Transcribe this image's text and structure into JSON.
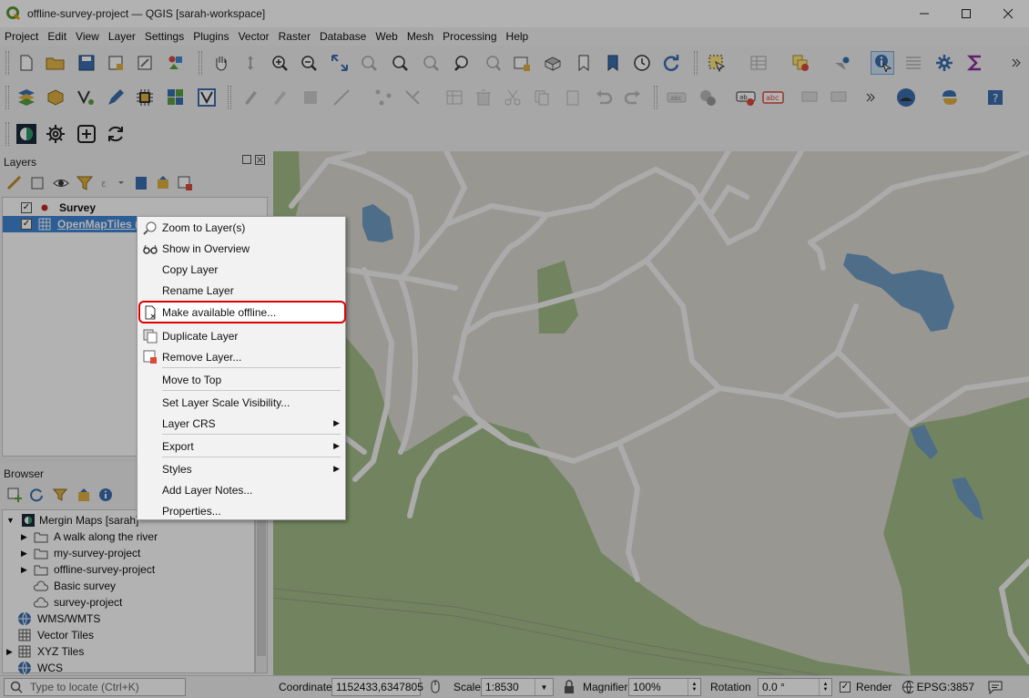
{
  "window": {
    "title": "offline-survey-project — QGIS [sarah-workspace]"
  },
  "menubar": [
    "Project",
    "Edit",
    "View",
    "Layer",
    "Settings",
    "Plugins",
    "Vector",
    "Raster",
    "Database",
    "Web",
    "Mesh",
    "Processing",
    "Help"
  ],
  "layers_panel": {
    "title": "Layers",
    "layers": [
      {
        "name": "Survey",
        "checked": true,
        "icon": "point-layer-icon"
      },
      {
        "name": "OpenMapTiles (",
        "checked": true,
        "icon": "vector-tile-layer-icon",
        "selected": true
      }
    ]
  },
  "context_menu": {
    "items": [
      {
        "label": "Zoom to Layer(s)",
        "icon": "zoom-to-layer-icon"
      },
      {
        "label": "Show in Overview",
        "icon": "overview-icon"
      },
      {
        "label": "Copy Layer"
      },
      {
        "label": "Rename Layer"
      },
      {
        "label": "Make available offline...",
        "icon": "offline-file-icon",
        "highlighted": true
      },
      {
        "label": "Duplicate Layer",
        "icon": "duplicate-icon"
      },
      {
        "label": "Remove Layer...",
        "icon": "remove-layer-icon"
      },
      {
        "label": "Move to Top"
      },
      {
        "label": "Set Layer Scale Visibility..."
      },
      {
        "label": "Layer CRS",
        "submenu": true
      },
      {
        "label": "Export",
        "submenu": true
      },
      {
        "label": "Styles",
        "submenu": true
      },
      {
        "label": "Add Layer Notes..."
      },
      {
        "label": "Properties..."
      }
    ]
  },
  "browser_panel": {
    "title": "Browser",
    "items": [
      {
        "label": "Mergin Maps [sarah]",
        "level": 0,
        "icon": "mergin-maps-icon",
        "expanded": true
      },
      {
        "label": "A walk along the river",
        "level": 1,
        "icon": "folder-icon"
      },
      {
        "label": "my-survey-project",
        "level": 1,
        "icon": "folder-icon"
      },
      {
        "label": "offline-survey-project",
        "level": 1,
        "icon": "folder-icon"
      },
      {
        "label": "Basic survey",
        "level": 1,
        "icon": "cloud-icon"
      },
      {
        "label": "survey-project",
        "level": 1,
        "icon": "cloud-icon"
      },
      {
        "label": "WMS/WMTS",
        "level": 0,
        "icon": "globe-icon"
      },
      {
        "label": "Vector Tiles",
        "level": 0,
        "icon": "grid-icon"
      },
      {
        "label": "XYZ Tiles",
        "level": 0,
        "icon": "grid-icon"
      },
      {
        "label": "WCS",
        "level": 0,
        "icon": "globe-icon"
      }
    ]
  },
  "statusbar": {
    "locate_placeholder": "Type to locate (Ctrl+K)",
    "coordinate_label": "Coordinate",
    "coordinate_value": "1152433,6347805",
    "scale_label": "Scale",
    "scale_value": "1:8530",
    "magnifier_label": "Magnifier",
    "magnifier_value": "100%",
    "rotation_label": "Rotation",
    "rotation_value": "0.0 °",
    "render_label": "Render",
    "render_checked": true,
    "crs": "EPSG:3857"
  },
  "colors": {
    "map_background": "#dcd8d0",
    "vegetation": "#a3be88",
    "water": "#6f9cc4",
    "roads": "#f5f5f5",
    "highlight_border": "#e00000",
    "selection": "#3f86d6"
  }
}
